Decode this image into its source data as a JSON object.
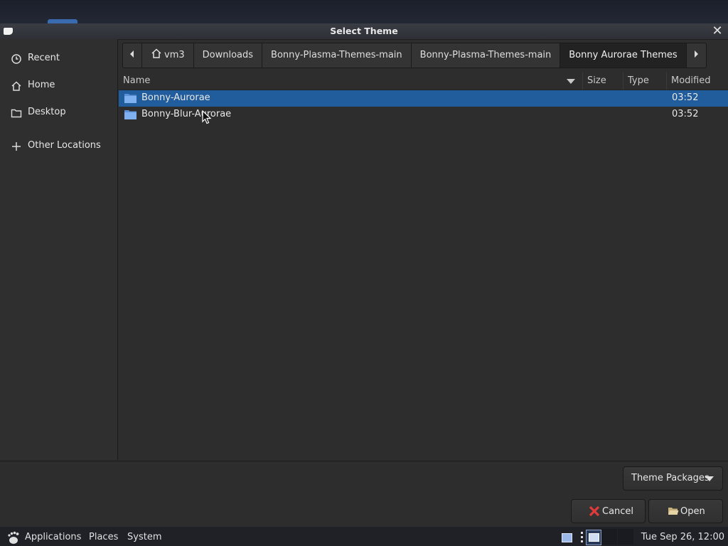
{
  "dialog": {
    "title": "Select Theme"
  },
  "sidebar": {
    "items": [
      {
        "label": "Recent",
        "icon": "clock-icon"
      },
      {
        "label": "Home",
        "icon": "home-icon"
      },
      {
        "label": "Desktop",
        "icon": "folder-icon"
      },
      {
        "label": "Other Locations",
        "icon": "plus-icon"
      }
    ]
  },
  "pathbar": {
    "crumbs": [
      "vm3",
      "Downloads",
      "Bonny-Plasma-Themes-main",
      "Bonny-Plasma-Themes-main",
      "Bonny Aurorae Themes"
    ],
    "active_crumb": "Bonny Aurorae Themes"
  },
  "columns": {
    "name": "Name",
    "size": "Size",
    "type": "Type",
    "modified": "Modified"
  },
  "files": [
    {
      "name": "Bonny-Aurorae",
      "size": "",
      "type": "",
      "modified": "03:52",
      "selected": true
    },
    {
      "name": "Bonny-Blur-Aurorae",
      "size": "",
      "type": "",
      "modified": "03:52",
      "selected": false
    }
  ],
  "filter": {
    "label": "Theme Packages"
  },
  "buttons": {
    "cancel": "Cancel",
    "open": "Open"
  },
  "panel": {
    "menus": [
      "Applications",
      "Places",
      "System"
    ],
    "clock": "Tue Sep 26, 12:00"
  },
  "colors": {
    "selection": "#215d9c",
    "background": "#2d2d2d",
    "cancel_icon": "#e03b3b"
  }
}
